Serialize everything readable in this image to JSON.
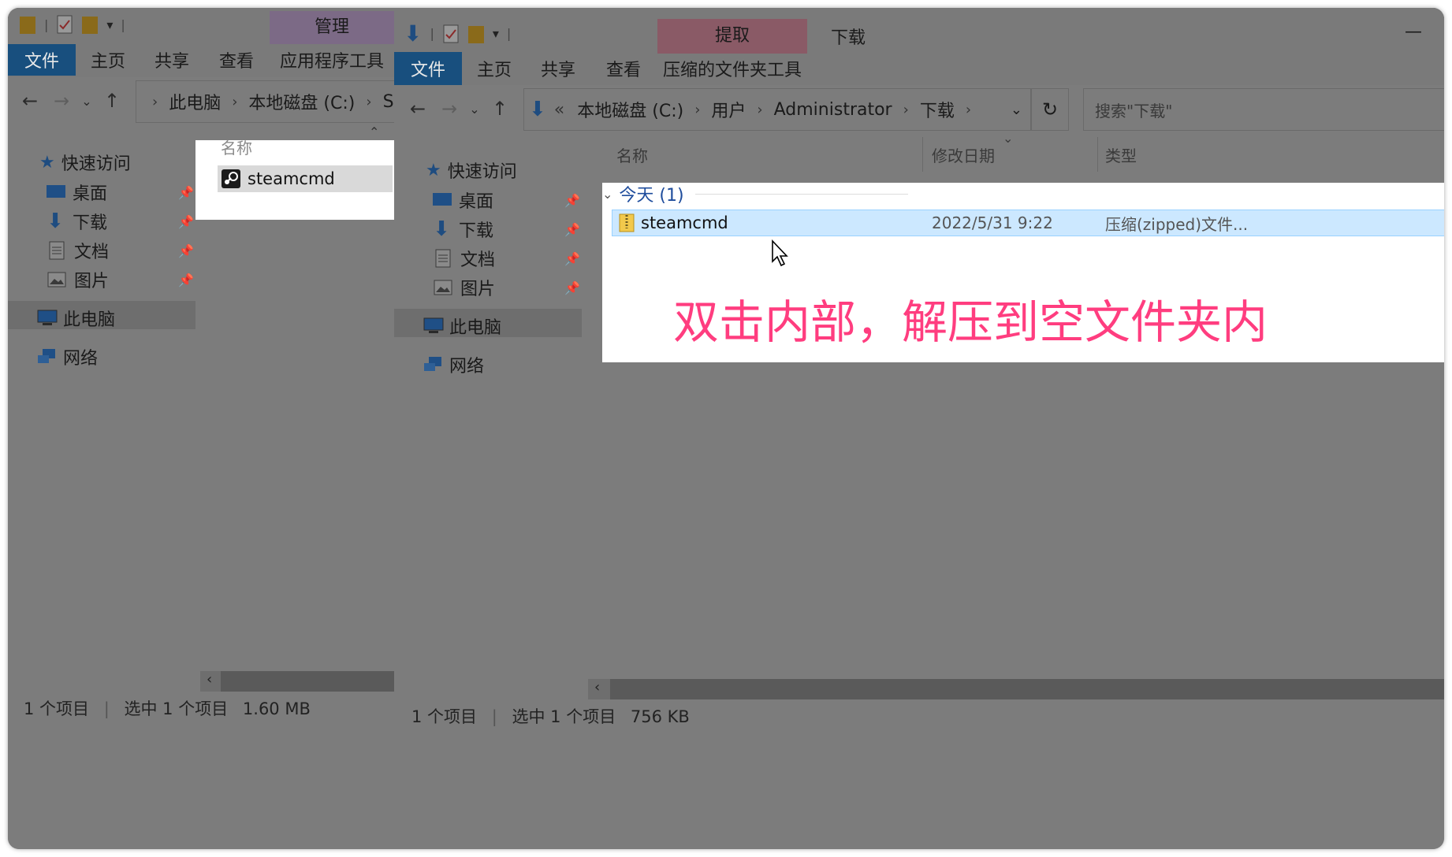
{
  "left_window": {
    "context_tab_group": "管理",
    "tabs": [
      "文件",
      "主页",
      "共享",
      "查看",
      "应用程序工具"
    ],
    "breadcrumb": [
      "此电脑",
      "本地磁盘 (C:)",
      "Ste"
    ],
    "column_name": "名称",
    "file_name": "steamcmd",
    "sidebar": {
      "quick_access": "快速访问",
      "items": [
        "桌面",
        "下载",
        "文档",
        "图片"
      ],
      "this_pc": "此电脑",
      "network": "网络"
    },
    "status": {
      "count": "1 个项目",
      "selected": "选中 1 个项目",
      "size": "1.60 MB"
    }
  },
  "right_window": {
    "title": "下载",
    "context_tab_group": "提取",
    "tabs": [
      "文件",
      "主页",
      "共享",
      "查看",
      "压缩的文件夹工具"
    ],
    "breadcrumb": [
      "本地磁盘 (C:)",
      "用户",
      "Administrator",
      "下载"
    ],
    "breadcrumb_overflow": "«",
    "search_placeholder": "搜索\"下载\"",
    "columns": {
      "name": "名称",
      "date": "修改日期",
      "type": "类型"
    },
    "group_header": "今天 (1)",
    "file": {
      "name": "steamcmd",
      "date": "2022/5/31 9:22",
      "type": "压缩(zipped)文件..."
    },
    "sidebar": {
      "quick_access": "快速访问",
      "items": [
        "桌面",
        "下载",
        "文档",
        "图片"
      ],
      "this_pc": "此电脑",
      "network": "网络"
    },
    "status": {
      "count": "1 个项目",
      "selected": "选中 1 个项目",
      "size": "756 KB"
    }
  },
  "annotation": "双击内部，解压到空文件夹内",
  "colors": {
    "accent": "#184f7e",
    "annotation": "#ff3d7f",
    "selection": "#cce8ff",
    "dim_bg": "#7c7c7c"
  }
}
